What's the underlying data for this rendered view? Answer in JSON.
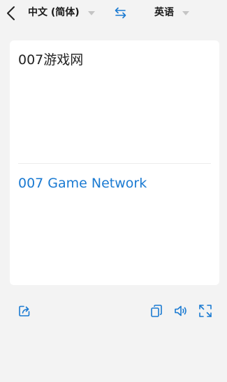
{
  "header": {
    "source_language": "中文 (简体)",
    "target_language": "英语"
  },
  "translation": {
    "source_text": "007游戏网",
    "result_text": "007 Game Network"
  },
  "icons": {
    "back": "back-arrow-icon",
    "swap": "swap-languages-icon",
    "share": "share-icon",
    "copy": "copy-icon",
    "speak": "speaker-icon",
    "fullscreen": "fullscreen-icon"
  },
  "colors": {
    "accent": "#1a7ad2",
    "background": "#f3f3f3",
    "card": "#ffffff"
  }
}
